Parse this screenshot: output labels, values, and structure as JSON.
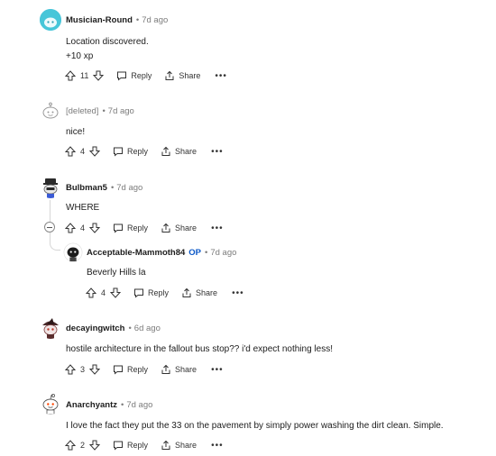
{
  "comments": [
    {
      "author": "Musician-Round",
      "time": "7d ago",
      "body_lines": [
        "Location discovered.",
        "+10 xp"
      ],
      "votes": "11",
      "reply_label": "Reply",
      "share_label": "Share",
      "more_label": "•••",
      "avatar": "teal-snoo-avatar"
    },
    {
      "author": "[deleted]",
      "time": "7d ago",
      "body_lines": [
        "nice!"
      ],
      "votes": "4",
      "reply_label": "Reply",
      "share_label": "Share",
      "more_label": "•••",
      "avatar": "deleted-snoo-avatar"
    },
    {
      "author": "Bulbman5",
      "time": "7d ago",
      "body_lines": [
        "WHERE"
      ],
      "votes": "4",
      "reply_label": "Reply",
      "share_label": "Share",
      "more_label": "•••",
      "avatar": "dark-hat-snoo-avatar",
      "reply": {
        "author": "Acceptable-Mammoth84",
        "op_label": "OP",
        "time": "7d ago",
        "body_lines": [
          "Beverly Hills la"
        ],
        "votes": "4",
        "reply_label": "Reply",
        "share_label": "Share",
        "more_label": "•••",
        "avatar": "black-white-snoo-avatar"
      }
    },
    {
      "author": "decayingwitch",
      "time": "6d ago",
      "body_lines": [
        "hostile architecture in the fallout bus stop?? i'd expect nothing less!"
      ],
      "votes": "3",
      "reply_label": "Reply",
      "share_label": "Share",
      "more_label": "•••",
      "avatar": "witch-snoo-avatar"
    },
    {
      "author": "Anarchyantz",
      "time": "7d ago",
      "body_lines": [
        "I love the fact they put the 33 on the pavement by simply power washing the dirt clean. Simple."
      ],
      "votes": "2",
      "reply_label": "Reply",
      "share_label": "Share",
      "more_label": "•••",
      "avatar": "default-snoo-avatar"
    }
  ],
  "colors": {
    "op": "#0a57c7",
    "meta": "#7c7c7c",
    "thread_line": "#d6d6d6"
  }
}
